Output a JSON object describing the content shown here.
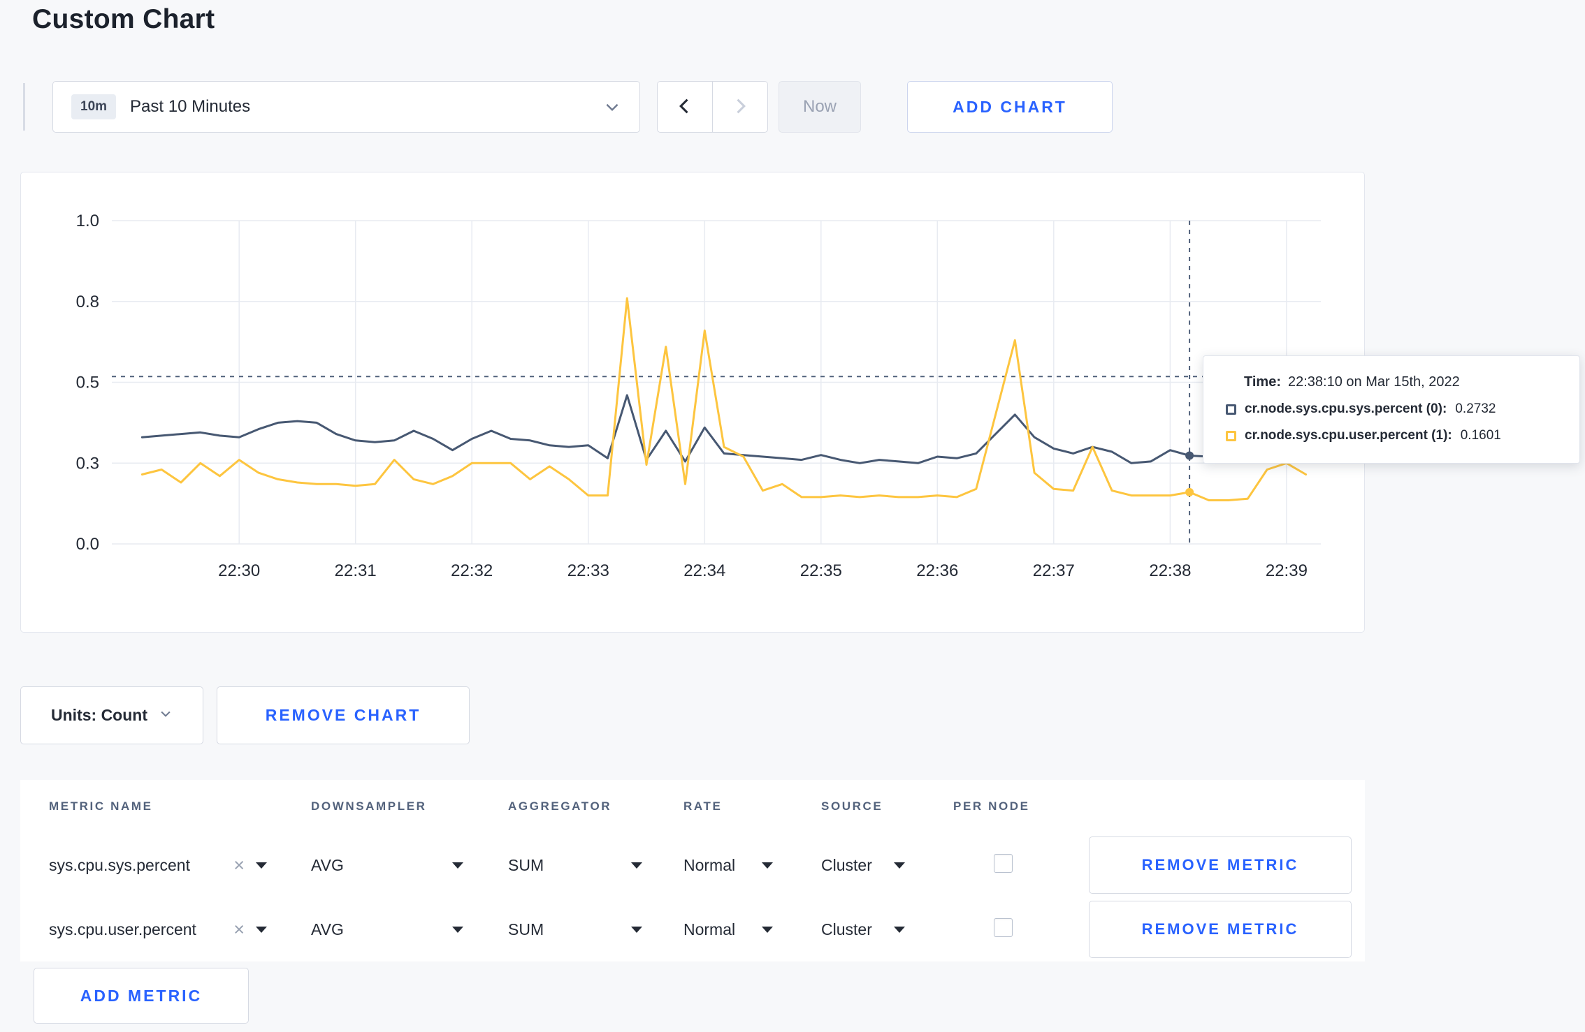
{
  "page": {
    "title": "Custom Chart"
  },
  "icons": {
    "clear": "×"
  },
  "toolbar": {
    "time_range": {
      "badge": "10m",
      "label": "Past 10 Minutes"
    },
    "now_button": "Now",
    "add_chart_button": "ADD CHART"
  },
  "chart_data": {
    "type": "line",
    "title": "",
    "xlabel": "",
    "ylabel": "",
    "ylim": [
      0,
      1
    ],
    "grid": true,
    "start_time": "22:29:10",
    "sample_interval_seconds": 10,
    "x_tick_labels": [
      "22:30",
      "22:31",
      "22:32",
      "22:33",
      "22:34",
      "22:35",
      "22:36",
      "22:37",
      "22:38",
      "22:39"
    ],
    "y_ticks": [
      {
        "value": 0,
        "label": "0.0"
      },
      {
        "value": 0.25,
        "label": "0.3"
      },
      {
        "value": 0.5,
        "label": "0.5"
      },
      {
        "value": 0.75,
        "label": "0.8"
      },
      {
        "value": 1,
        "label": "1.0"
      }
    ],
    "series": [
      {
        "name": "cr.node.sys.cpu.sys.percent",
        "color": "#475872",
        "values": [
          0.33,
          0.335,
          0.34,
          0.345,
          0.335,
          0.33,
          0.355,
          0.375,
          0.38,
          0.375,
          0.34,
          0.32,
          0.315,
          0.32,
          0.35,
          0.325,
          0.29,
          0.325,
          0.35,
          0.325,
          0.32,
          0.305,
          0.3,
          0.305,
          0.265,
          0.46,
          0.26,
          0.35,
          0.255,
          0.36,
          0.28,
          0.275,
          0.27,
          0.265,
          0.26,
          0.275,
          0.26,
          0.25,
          0.26,
          0.255,
          0.25,
          0.27,
          0.265,
          0.28,
          0.34,
          0.4,
          0.33,
          0.295,
          0.28,
          0.3,
          0.285,
          0.25,
          0.255,
          0.29,
          0.2732,
          0.27,
          0.275,
          0.27,
          0.275,
          0.28,
          0.28
        ]
      },
      {
        "name": "cr.node.sys.cpu.user.percent",
        "color": "#fdc53f",
        "values": [
          0.215,
          0.23,
          0.19,
          0.25,
          0.21,
          0.26,
          0.22,
          0.2,
          0.19,
          0.185,
          0.185,
          0.18,
          0.185,
          0.26,
          0.2,
          0.185,
          0.21,
          0.25,
          0.25,
          0.25,
          0.2,
          0.24,
          0.2,
          0.15,
          0.15,
          0.76,
          0.245,
          0.61,
          0.185,
          0.66,
          0.3,
          0.27,
          0.165,
          0.185,
          0.145,
          0.145,
          0.15,
          0.145,
          0.15,
          0.145,
          0.145,
          0.15,
          0.145,
          0.17,
          0.4,
          0.63,
          0.22,
          0.17,
          0.165,
          0.3,
          0.165,
          0.15,
          0.15,
          0.15,
          0.1601,
          0.135,
          0.135,
          0.14,
          0.23,
          0.25,
          0.215
        ]
      }
    ],
    "crosshair": {
      "index": 54,
      "time": "22:38:10",
      "hline_value": 0.518
    }
  },
  "tooltip": {
    "time_label": "Time:",
    "time_value": "22:38:10 on Mar 15th, 2022",
    "rows": [
      {
        "name": "cr.node.sys.cpu.sys.percent (0):",
        "value": "0.2732",
        "color": "#475872"
      },
      {
        "name": "cr.node.sys.cpu.user.percent (1):",
        "value": "0.1601",
        "color": "#fdc53f"
      }
    ]
  },
  "chart_controls": {
    "units_button": "Units: Count",
    "remove_chart_button": "REMOVE CHART"
  },
  "metrics_table": {
    "headers": [
      "METRIC NAME",
      "DOWNSAMPLER",
      "AGGREGATOR",
      "RATE",
      "SOURCE",
      "PER NODE"
    ],
    "rows": [
      {
        "metric": "sys.cpu.sys.percent",
        "downsampler": "AVG",
        "aggregator": "SUM",
        "rate": "Normal",
        "source": "Cluster",
        "per_node_checked": false,
        "remove_button": "REMOVE METRIC"
      },
      {
        "metric": "sys.cpu.user.percent",
        "downsampler": "AVG",
        "aggregator": "SUM",
        "rate": "Normal",
        "source": "Cluster",
        "per_node_checked": false,
        "remove_button": "REMOVE METRIC"
      }
    ],
    "add_metric_button": "ADD METRIC"
  },
  "colors": {
    "accent_blue": "#2962ff",
    "series_sys": "#475872",
    "series_user": "#fdc53f",
    "page_background": "#f7f8fa"
  }
}
